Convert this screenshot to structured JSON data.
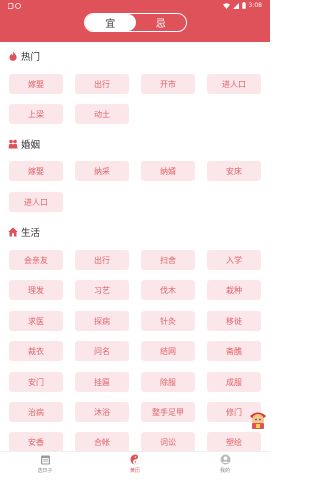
{
  "status": {
    "time": "3:08"
  },
  "segment": {
    "options": [
      "宜",
      "忌"
    ],
    "selected": "宜"
  },
  "sections": [
    {
      "title": "热门",
      "icon": "fire-icon",
      "tags": [
        "嫁娶",
        "出行",
        "开市",
        "进人口",
        "上梁",
        "动土"
      ]
    },
    {
      "title": "婚姻",
      "icon": "couple-icon",
      "tags": [
        "嫁娶",
        "纳采",
        "纳婿",
        "安床",
        "进人口"
      ]
    },
    {
      "title": "生活",
      "icon": "house-icon",
      "tags": [
        "会亲友",
        "出行",
        "扫舍",
        "入学",
        "理发",
        "习艺",
        "伐木",
        "栽种",
        "求医",
        "探病",
        "针灸",
        "移徙",
        "裁衣",
        "问名",
        "结网",
        "斋醮",
        "安门",
        "挂匾",
        "除服",
        "成服",
        "治病",
        "沐浴",
        "整手足甲",
        "修门",
        "安香",
        "合帐",
        "词讼",
        "塑绘"
      ]
    }
  ],
  "tabs": [
    {
      "label": "选日子",
      "icon": "calendar-icon"
    },
    {
      "label": "黄历",
      "icon": "yin-yang-icon"
    },
    {
      "label": "我的",
      "icon": "profile-icon"
    }
  ],
  "colors": {
    "accent": "#e0525a",
    "tag_bg": "#fbe7e9",
    "tag_text": "#e26169"
  }
}
